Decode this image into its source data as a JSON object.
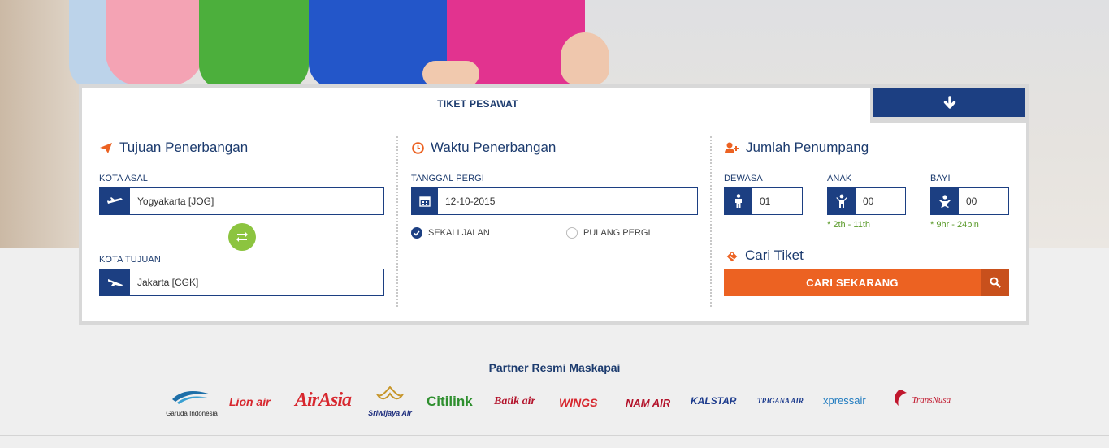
{
  "tabs": {
    "active_label": "TIKET PESAWAT",
    "toggle_icon": "arrow-down-icon"
  },
  "route": {
    "title": "Tujuan Penerbangan",
    "origin_label": "KOTA ASAL",
    "origin_value": "Yogyakarta [JOG]",
    "destination_label": "KOTA TUJUAN",
    "destination_value": "Jakarta [CGK]"
  },
  "schedule": {
    "title": "Waktu Penerbangan",
    "date_label": "TANGGAL PERGI",
    "date_value": "12-10-2015",
    "trip_options": [
      {
        "label": "SEKALI JALAN",
        "selected": true
      },
      {
        "label": "PULANG PERGI",
        "selected": false
      }
    ]
  },
  "passengers": {
    "title": "Jumlah Penumpang",
    "adult_label": "DEWASA",
    "adult_value": "01",
    "child_label": "ANAK",
    "child_value": "00",
    "child_note": "* 2th - 11th",
    "infant_label": "BAYI",
    "infant_value": "00",
    "infant_note": "* 9hr - 24bln"
  },
  "search": {
    "title": "Cari Tiket",
    "button_label": "CARI SEKARANG"
  },
  "partners": {
    "title": "Partner Resmi Maskapai",
    "logos": [
      "Garuda Indonesia",
      "Lion air",
      "AirAsia",
      "Sriwijaya Air",
      "Citilink",
      "Batik air",
      "WINGS",
      "NAM AIR",
      "KALSTAR",
      "TRIGANA AIR",
      "xpressair",
      "TransNusa"
    ]
  },
  "colors": {
    "navy": "#1c3f82",
    "orange": "#ec6222",
    "green": "#8cc43f"
  }
}
